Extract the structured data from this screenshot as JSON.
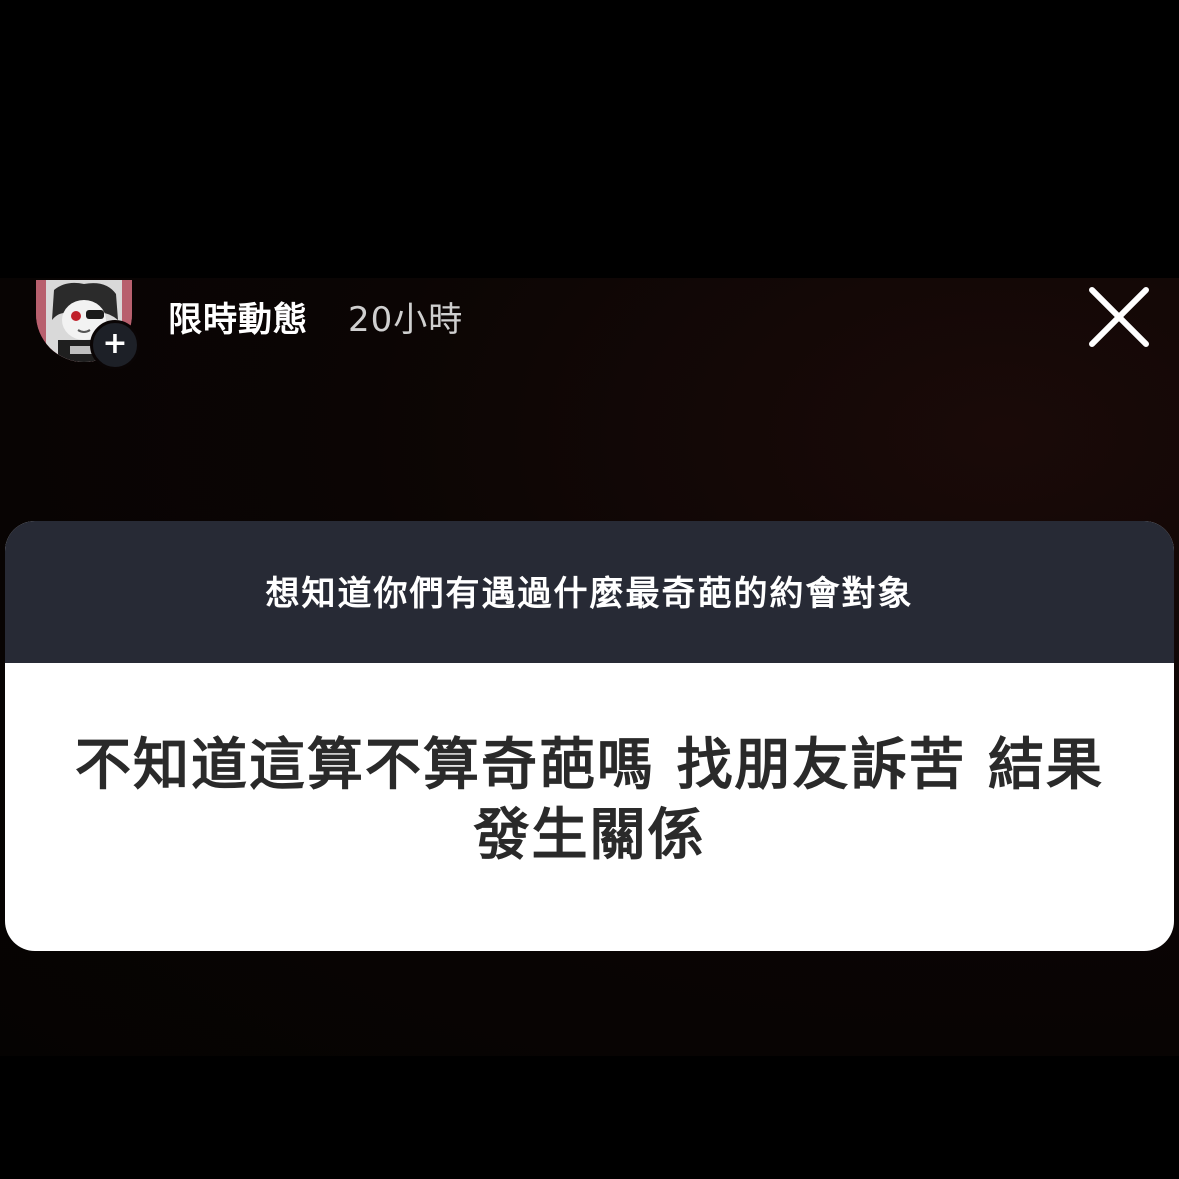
{
  "header": {
    "username": "限時動態",
    "time": "20小時",
    "add_label": "+",
    "avatar_icon": "avatar-image",
    "close_icon": "close-x"
  },
  "question_sticker": {
    "question": "想知道你們有遇過什麼最奇葩的約會對象",
    "answer": "不知道這算不算奇葩嗎 找朋友訴苦 結果發生關係"
  },
  "colors": {
    "background": "#000000",
    "question_bar": "#272a35",
    "answer_card": "#ffffff",
    "answer_text": "#2a2a2a"
  }
}
